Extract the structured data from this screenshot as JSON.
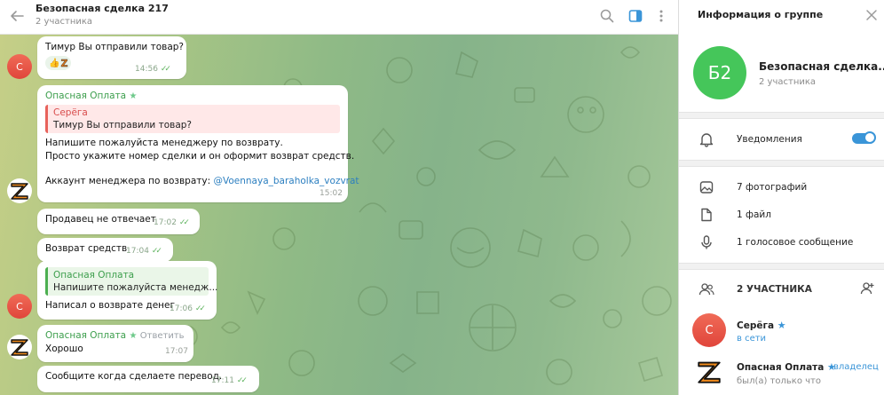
{
  "header": {
    "title": "Безопасная сделка 217",
    "subtitle": "2 участника"
  },
  "messages": {
    "m1": {
      "text": "Тимур Вы отправили товар?",
      "emoji": "👍",
      "z_letter": "Z",
      "time": "14:56"
    },
    "m2": {
      "sender": "Опасная Оплата",
      "quote_name": "Серёга",
      "quote_text": "Тимур Вы отправили товар?",
      "line1": "Напишите пожалуйста менеджеру по возврату.",
      "line2": "Просто укажите номер сделки и он оформит возврат средств.",
      "line3_prefix": "Аккаунт менеджера по возврату: ",
      "line3_link": "@Voennaya_baraholka_vozvrat",
      "time": "15:02"
    },
    "m3": {
      "text": "Продавец не отвечает",
      "time": "17:02"
    },
    "m4": {
      "text": "Возврат средств",
      "time": "17:04"
    },
    "m5": {
      "quote_name": "Опасная Оплата",
      "quote_text": "Напишите пожалуйста менедж...",
      "text": "Написал о возврате денег",
      "time": "17:06"
    },
    "m6": {
      "sender": "Опасная Оплата",
      "reply": "Ответить",
      "text": "Хорошо",
      "time": "17:07"
    },
    "m7": {
      "text": "Сообщите когда сделаете перевод.",
      "time": "17:11"
    }
  },
  "avatars": {
    "user_initial": "С"
  },
  "panel": {
    "title": "Информация о группе",
    "avatar_text": "Б2",
    "group_name": "Безопасная сделка...",
    "group_sub": "2 участника",
    "notifications": "Уведомления",
    "photos": "7 фотографий",
    "files": "1 файл",
    "voice": "1 голосовое сообщение",
    "members_header": "2 УЧАСТНИКА",
    "members": [
      {
        "initial": "С",
        "name": "Серёга",
        "status": "в сети"
      },
      {
        "name": "Опасная Оплата",
        "role": "владелец",
        "status": "был(а) только что"
      }
    ]
  },
  "colors": {
    "accent": "#3a95d8",
    "green_name": "#3c9e4c",
    "group_avatar": "#45c65a",
    "user_avatar": "#e8503f"
  }
}
